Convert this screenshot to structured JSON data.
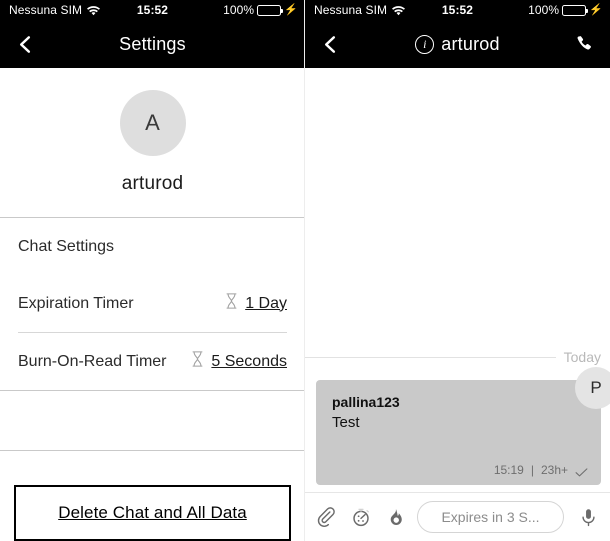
{
  "status_bar": {
    "carrier": "Nessuna SIM",
    "wifi_icon": "wifi-icon",
    "time": "15:52",
    "battery_percent": "100%",
    "battery_icon": "battery-icon",
    "charging_icon": "lightning-bolt-icon",
    "battery_color": "#3cdb5a"
  },
  "settings_pane": {
    "nav": {
      "back_icon": "chevron-left-icon",
      "title": "Settings"
    },
    "profile": {
      "avatar_initial": "A",
      "name": "arturod"
    },
    "rows": [
      {
        "label": "Chat Settings",
        "value": "",
        "icon": ""
      },
      {
        "label": "Expiration Timer",
        "value": "1 Day",
        "icon": "hourglass-icon"
      },
      {
        "label": "Burn-On-Read Timer",
        "value": "5 Seconds",
        "icon": "hourglass-icon"
      }
    ],
    "delete_button": "Delete Chat and All Data"
  },
  "chat_pane": {
    "nav": {
      "back_icon": "chevron-left-icon",
      "info_icon": "info-circle-icon",
      "title": "arturod",
      "call_icon": "phone-icon"
    },
    "day_separator": "Today",
    "message": {
      "sender": "pallina123",
      "text": "Test",
      "time": "15:19",
      "expiry": "23h+",
      "separator": "|",
      "status_icon": "checkmark-icon",
      "avatar_initial": "P"
    },
    "composer": {
      "attach_icon": "paperclip-icon",
      "timer_icon": "stopwatch-icon",
      "burn_icon": "flame-icon",
      "input_value": "",
      "input_placeholder": "Expires in 3 S...",
      "mic_icon": "microphone-icon"
    }
  }
}
